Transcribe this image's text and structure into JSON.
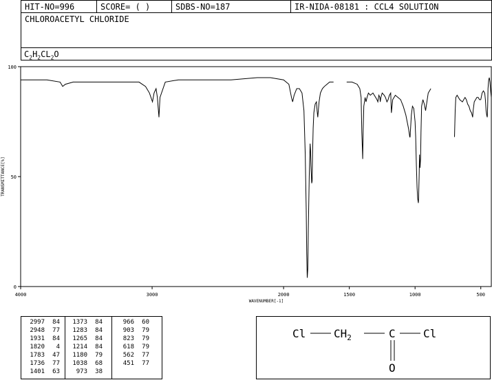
{
  "header": {
    "hit_no": "HIT-NO=996",
    "score": "SCORE=  (   )",
    "sdbs_no": "SDBS-NO=187",
    "ir_info": "IR-NIDA-08181 : CCL4 SOLUTION"
  },
  "compound": {
    "name": "CHLOROACETYL CHLORIDE",
    "formula_parts": [
      {
        "t": "C",
        "sub": "2"
      },
      {
        "t": "H",
        "sub": "2"
      },
      {
        "t": "CL",
        "sub": "2"
      },
      {
        "t": "O",
        "sub": ""
      }
    ]
  },
  "chart_data": {
    "type": "line",
    "xlabel": "WAVENUMBER[-1]",
    "ylabel": "TRANSMITTANCE[%]",
    "xlim": [
      4000,
      420
    ],
    "ylim": [
      0,
      100
    ],
    "x_ticks": [
      4000,
      3000,
      2000,
      1500,
      1000,
      500
    ],
    "y_ticks": [
      0,
      50,
      100
    ],
    "segments": [
      {
        "x": [
          4000,
          3900,
          3800,
          3700,
          3680,
          3660,
          3600,
          3500,
          3400,
          3300,
          3200,
          3100,
          3050,
          3020,
          2997,
          2985,
          2970,
          2960,
          2955,
          2948,
          2940,
          2900,
          2800,
          2600,
          2400,
          2200,
          2100,
          2000,
          1960,
          1950,
          1940,
          1931,
          1920,
          1900,
          1880,
          1860,
          1845,
          1835,
          1828,
          1824,
          1820,
          1816,
          1812,
          1805,
          1798,
          1795,
          1792,
          1788,
          1786,
          1783,
          1780,
          1775,
          1770,
          1760,
          1750,
          1745,
          1740,
          1736,
          1730,
          1720,
          1705,
          1690,
          1670,
          1650,
          1620
        ],
        "y": [
          94,
          94,
          94,
          93,
          91,
          92,
          93,
          93,
          93,
          93,
          93,
          93,
          91,
          88,
          84,
          88,
          90,
          86,
          82,
          77,
          86,
          93,
          94,
          94,
          94,
          95,
          95,
          94,
          92,
          89,
          86,
          84,
          87,
          90,
          90,
          88,
          80,
          60,
          35,
          15,
          4,
          8,
          25,
          50,
          65,
          62,
          55,
          50,
          47,
          48,
          60,
          72,
          79,
          83,
          84,
          80,
          77,
          80,
          84,
          88,
          90,
          91,
          92,
          93,
          93
        ]
      },
      {
        "x": [
          1520,
          1480,
          1440,
          1420,
          1410,
          1405,
          1401,
          1398,
          1395,
          1390,
          1380,
          1373,
          1365,
          1355,
          1340,
          1320,
          1300,
          1290,
          1283,
          1275,
          1268,
          1265,
          1260,
          1250,
          1235,
          1225,
          1214,
          1205,
          1195,
          1185,
          1180,
          1170,
          1150,
          1130,
          1110,
          1090,
          1070,
          1050,
          1045,
          1040,
          1038,
          1034,
          1028,
          1020,
          1010,
          1000,
          995,
          990,
          985,
          980,
          975,
          973,
          969,
          966,
          962,
          958,
          955,
          950,
          940,
          930,
          920,
          910,
          900,
          890,
          880
        ],
        "y": [
          93,
          93,
          92,
          90,
          86,
          70,
          63,
          58,
          70,
          82,
          86,
          84,
          86,
          88,
          87,
          88,
          86,
          85,
          84,
          87,
          86,
          84,
          86,
          88,
          87,
          86,
          84,
          85,
          87,
          88,
          79,
          85,
          87,
          86,
          85,
          82,
          78,
          72,
          70,
          68,
          68,
          72,
          78,
          82,
          81,
          75,
          68,
          55,
          45,
          40,
          38,
          40,
          50,
          60,
          54,
          58,
          70,
          82,
          85,
          83,
          80,
          84,
          88,
          89,
          90
        ]
      },
      {
        "x": [
          700,
          695,
          690,
          680,
          670,
          660,
          640,
          630,
          620,
          610,
          600,
          590,
          580,
          570,
          566,
          562,
          558,
          550,
          540,
          530,
          520,
          510,
          500,
          490,
          480,
          470,
          465,
          460,
          455,
          451,
          448,
          445,
          440,
          435,
          430,
          425,
          420
        ],
        "y": [
          68,
          80,
          86,
          87,
          86,
          85,
          84,
          85,
          86,
          85,
          83,
          82,
          80,
          79,
          78,
          77,
          80,
          84,
          85,
          86,
          86,
          85,
          85,
          88,
          89,
          88,
          85,
          80,
          78,
          77,
          82,
          90,
          94,
          95,
          93,
          89,
          86
        ]
      }
    ]
  },
  "peaks": {
    "columns": [
      {
        "rows": [
          [
            "2997",
            "84"
          ],
          [
            "2948",
            "77"
          ],
          [
            "1931",
            "84"
          ],
          [
            "1820",
            "4"
          ],
          [
            "1783",
            "47"
          ],
          [
            "1736",
            "77"
          ],
          [
            "1401",
            "63"
          ]
        ]
      },
      {
        "rows": [
          [
            "1373",
            "84"
          ],
          [
            "1283",
            "84"
          ],
          [
            "1265",
            "84"
          ],
          [
            "1214",
            "84"
          ],
          [
            "1180",
            "79"
          ],
          [
            "1038",
            "68"
          ],
          [
            "973",
            "38"
          ]
        ]
      },
      {
        "rows": [
          [
            "966",
            "60"
          ],
          [
            "903",
            "79"
          ],
          [
            "823",
            "79"
          ],
          [
            "618",
            "79"
          ],
          [
            "562",
            "77"
          ],
          [
            "451",
            "77"
          ]
        ]
      }
    ]
  },
  "structure": {
    "cl_left": "Cl",
    "ch2_main": "CH",
    "ch2_sub": "2",
    "carbon": "C",
    "cl_right": "Cl",
    "oxygen": "O"
  }
}
